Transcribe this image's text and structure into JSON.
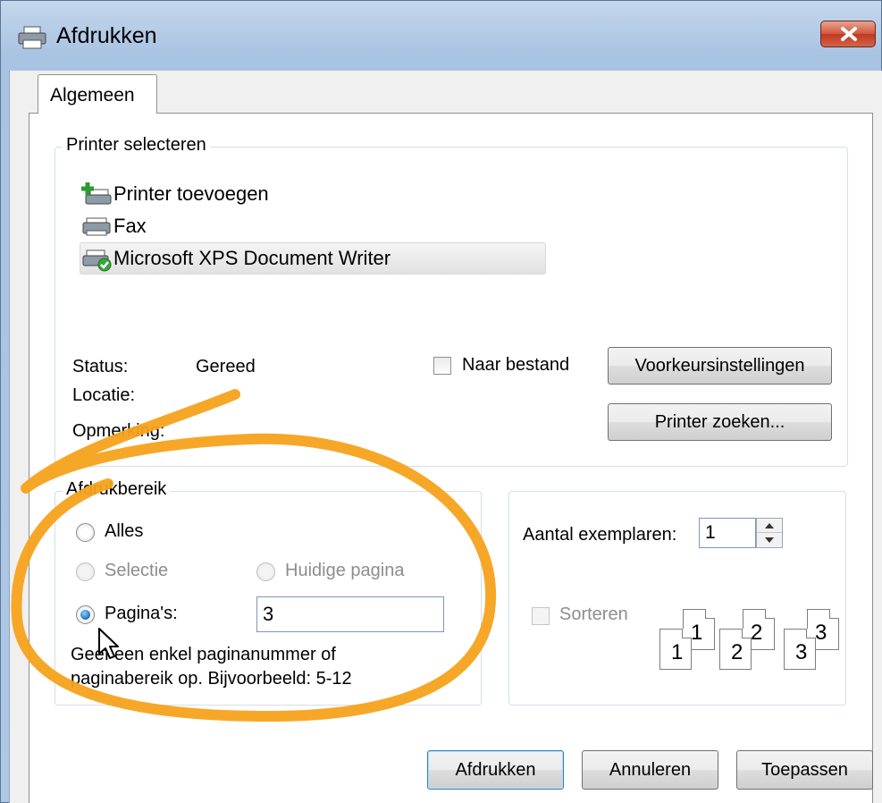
{
  "window": {
    "title": "Afdrukken",
    "close_icon": "close-icon"
  },
  "tabs": [
    {
      "label": "Algemeen",
      "active": true
    }
  ],
  "printer_group": {
    "label": "Printer selecteren",
    "printers": [
      {
        "name": "Printer toevoegen",
        "icon": "add-printer-icon"
      },
      {
        "name": "Fax",
        "icon": "fax-icon"
      },
      {
        "name": "Microsoft XPS Document Writer",
        "icon": "xps-printer-icon",
        "selected": true
      }
    ],
    "status_label": "Status:",
    "status_value": "Gereed",
    "location_label": "Locatie:",
    "comment_label": "Opmerking:",
    "to_file_label": "Naar bestand",
    "to_file_checked": false,
    "preferences_button": "Voorkeursinstellingen",
    "find_printer_button": "Printer zoeken..."
  },
  "range_group": {
    "label": "Afdrukbereik",
    "all_label": "Alles",
    "selection_label": "Selectie",
    "current_page_label": "Huidige pagina",
    "pages_label": "Pagina's:",
    "pages_value": "3",
    "selected_option": "pages",
    "help_line1": "Geef een enkel paginanummer of",
    "help_line2": "paginabereik op. Bijvoorbeeld: 5-12"
  },
  "copies_group": {
    "copies_label": "Aantal exemplaren:",
    "copies_value": "1",
    "collate_label": "Sorteren",
    "collate_checked": false,
    "collate_pages": [
      "1",
      "1",
      "2",
      "2",
      "3",
      "3"
    ]
  },
  "buttons": {
    "print": "Afdrukken",
    "cancel": "Annuleren",
    "apply": "Toepassen"
  },
  "colors": {
    "annotation": "#f7a21b",
    "title_gradient_top": "#c4d7ec",
    "close_red": "#c0391f",
    "radio_selected": "#1d6fb8"
  }
}
